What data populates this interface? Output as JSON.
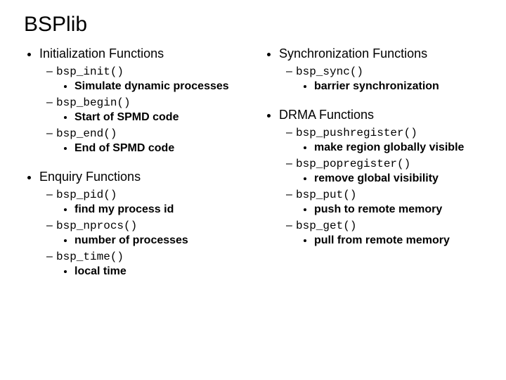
{
  "title": "BSPlib",
  "left": [
    {
      "heading": "Initialization Functions",
      "items": [
        {
          "fn": "bsp_init()",
          "desc": "Simulate dynamic processes"
        },
        {
          "fn": "bsp_begin()",
          "desc": "Start of SPMD code"
        },
        {
          "fn": "bsp_end()",
          "desc": "End of SPMD code"
        }
      ]
    },
    {
      "heading": "Enquiry Functions",
      "items": [
        {
          "fn": "bsp_pid()",
          "desc": "find my process id"
        },
        {
          "fn": "bsp_nprocs()",
          "desc": "number of processes"
        },
        {
          "fn": "bsp_time()",
          "desc": "local time"
        }
      ]
    }
  ],
  "right": [
    {
      "heading": "Synchronization Functions",
      "items": [
        {
          "fn": "bsp_sync()",
          "desc": "barrier synchronization"
        }
      ]
    },
    {
      "heading": "DRMA Functions",
      "items": [
        {
          "fn": "bsp_pushregister()",
          "desc": "make region globally visible"
        },
        {
          "fn": "bsp_popregister()",
          "desc": "remove global visibility"
        },
        {
          "fn": "bsp_put()",
          "desc": "push to remote memory"
        },
        {
          "fn": "bsp_get()",
          "desc": "pull from remote memory"
        }
      ]
    }
  ]
}
